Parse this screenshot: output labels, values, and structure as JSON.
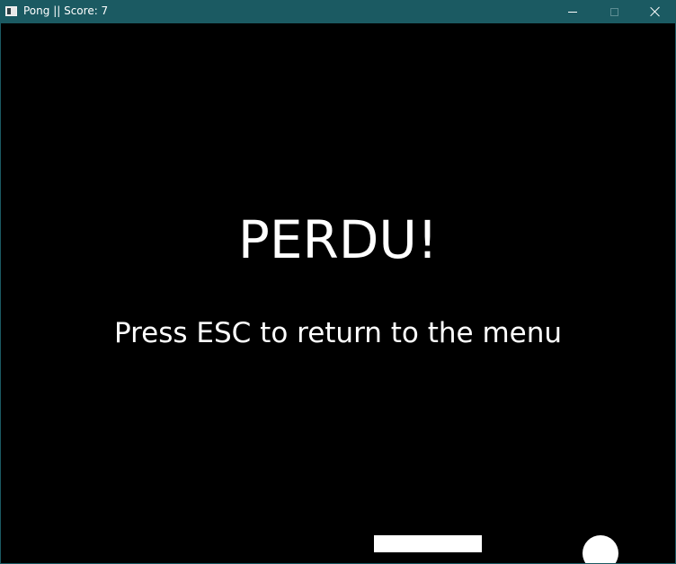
{
  "window": {
    "title": "Pong || Score: 7",
    "colors": {
      "titlebar": "#1b5a62",
      "background": "#000000",
      "foreground": "#ffffff"
    }
  },
  "controls": {
    "minimize_icon": "minimize-icon",
    "maximize_icon": "maximize-icon",
    "close_icon": "close-icon"
  },
  "game": {
    "headline": "PERDU!",
    "instruction": "Press ESC to return to the menu"
  }
}
